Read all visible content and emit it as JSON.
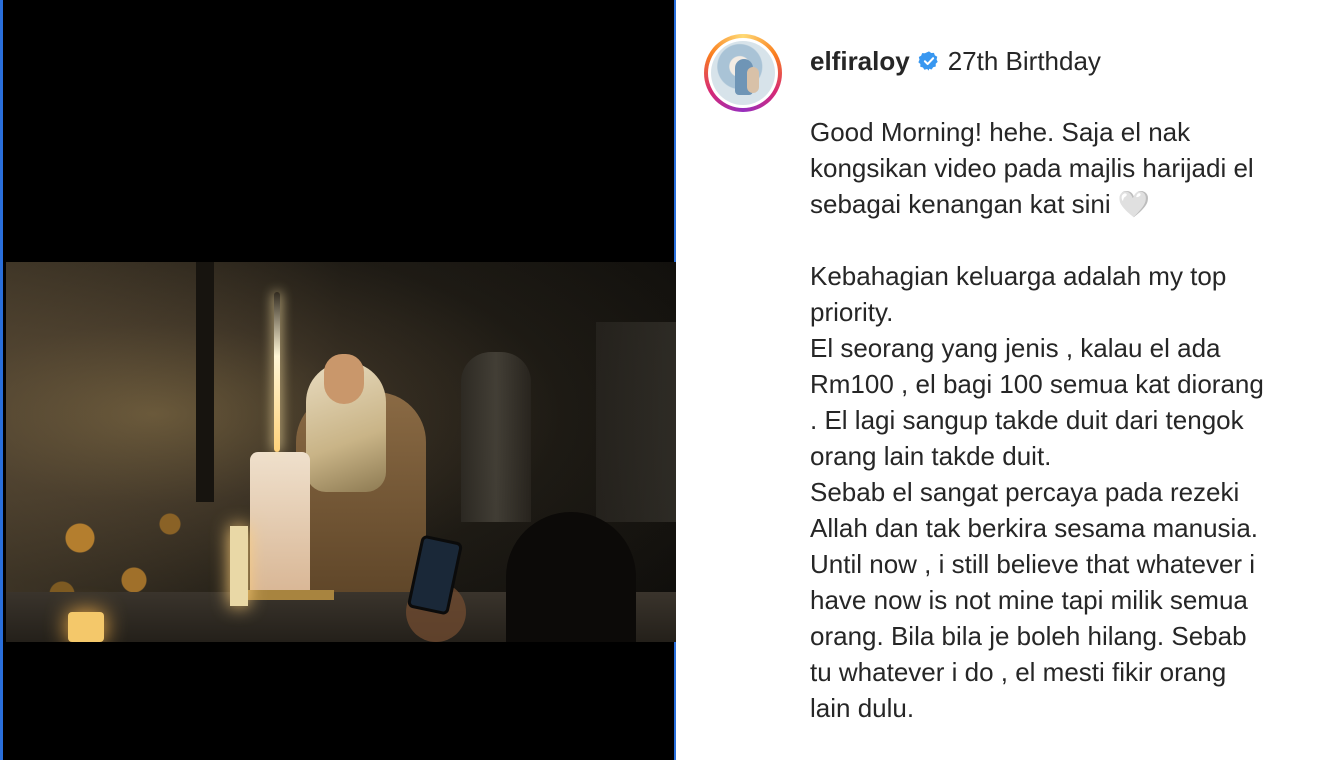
{
  "post": {
    "username": "elfiraloy",
    "verified": true,
    "location": "27th Birthday",
    "caption_lines": [
      "Good Morning! hehe. Saja el nak",
      "kongsikan video pada majlis harijadi el",
      "sebagai kenangan kat sini 🤍",
      "",
      "Kebahagian keluarga adalah my top",
      "priority.",
      "El seorang yang jenis , kalau el ada",
      "Rm100 , el bagi 100 semua kat diorang",
      ". El lagi sangup takde duit dari tengok",
      "orang lain takde duit.",
      "Sebab el sangat percaya pada rezeki",
      "Allah dan tak berkira sesama manusia.",
      "Until now , i still believe that whatever i",
      "have now is not mine tapi milik semua",
      "orang. Bila bila je boleh hilang. Sebab",
      "tu whatever i do , el mesti fikir orang",
      "lain dulu."
    ]
  },
  "icons": {
    "verified": "verified-badge-icon",
    "avatar_ring": "story-ring"
  },
  "colors": {
    "text": "#262626",
    "verified_blue": "#3897f0",
    "media_background": "#000000",
    "focus_border": "#2a6fdb"
  }
}
